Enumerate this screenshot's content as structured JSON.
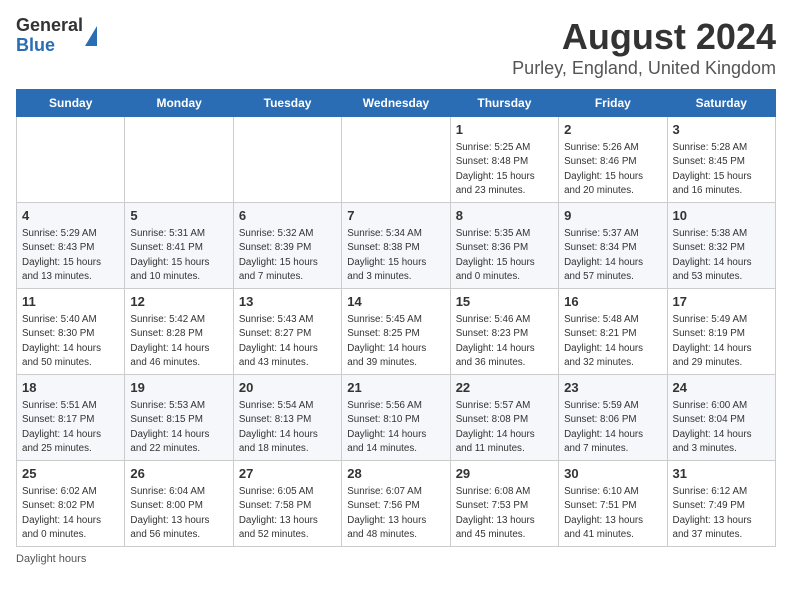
{
  "header": {
    "logo_general": "General",
    "logo_blue": "Blue",
    "title": "August 2024",
    "subtitle": "Purley, England, United Kingdom"
  },
  "days_of_week": [
    "Sunday",
    "Monday",
    "Tuesday",
    "Wednesday",
    "Thursday",
    "Friday",
    "Saturday"
  ],
  "weeks": [
    [
      {
        "day": "",
        "info": ""
      },
      {
        "day": "",
        "info": ""
      },
      {
        "day": "",
        "info": ""
      },
      {
        "day": "",
        "info": ""
      },
      {
        "day": "1",
        "info": "Sunrise: 5:25 AM\nSunset: 8:48 PM\nDaylight: 15 hours\nand 23 minutes."
      },
      {
        "day": "2",
        "info": "Sunrise: 5:26 AM\nSunset: 8:46 PM\nDaylight: 15 hours\nand 20 minutes."
      },
      {
        "day": "3",
        "info": "Sunrise: 5:28 AM\nSunset: 8:45 PM\nDaylight: 15 hours\nand 16 minutes."
      }
    ],
    [
      {
        "day": "4",
        "info": "Sunrise: 5:29 AM\nSunset: 8:43 PM\nDaylight: 15 hours\nand 13 minutes."
      },
      {
        "day": "5",
        "info": "Sunrise: 5:31 AM\nSunset: 8:41 PM\nDaylight: 15 hours\nand 10 minutes."
      },
      {
        "day": "6",
        "info": "Sunrise: 5:32 AM\nSunset: 8:39 PM\nDaylight: 15 hours\nand 7 minutes."
      },
      {
        "day": "7",
        "info": "Sunrise: 5:34 AM\nSunset: 8:38 PM\nDaylight: 15 hours\nand 3 minutes."
      },
      {
        "day": "8",
        "info": "Sunrise: 5:35 AM\nSunset: 8:36 PM\nDaylight: 15 hours\nand 0 minutes."
      },
      {
        "day": "9",
        "info": "Sunrise: 5:37 AM\nSunset: 8:34 PM\nDaylight: 14 hours\nand 57 minutes."
      },
      {
        "day": "10",
        "info": "Sunrise: 5:38 AM\nSunset: 8:32 PM\nDaylight: 14 hours\nand 53 minutes."
      }
    ],
    [
      {
        "day": "11",
        "info": "Sunrise: 5:40 AM\nSunset: 8:30 PM\nDaylight: 14 hours\nand 50 minutes."
      },
      {
        "day": "12",
        "info": "Sunrise: 5:42 AM\nSunset: 8:28 PM\nDaylight: 14 hours\nand 46 minutes."
      },
      {
        "day": "13",
        "info": "Sunrise: 5:43 AM\nSunset: 8:27 PM\nDaylight: 14 hours\nand 43 minutes."
      },
      {
        "day": "14",
        "info": "Sunrise: 5:45 AM\nSunset: 8:25 PM\nDaylight: 14 hours\nand 39 minutes."
      },
      {
        "day": "15",
        "info": "Sunrise: 5:46 AM\nSunset: 8:23 PM\nDaylight: 14 hours\nand 36 minutes."
      },
      {
        "day": "16",
        "info": "Sunrise: 5:48 AM\nSunset: 8:21 PM\nDaylight: 14 hours\nand 32 minutes."
      },
      {
        "day": "17",
        "info": "Sunrise: 5:49 AM\nSunset: 8:19 PM\nDaylight: 14 hours\nand 29 minutes."
      }
    ],
    [
      {
        "day": "18",
        "info": "Sunrise: 5:51 AM\nSunset: 8:17 PM\nDaylight: 14 hours\nand 25 minutes."
      },
      {
        "day": "19",
        "info": "Sunrise: 5:53 AM\nSunset: 8:15 PM\nDaylight: 14 hours\nand 22 minutes."
      },
      {
        "day": "20",
        "info": "Sunrise: 5:54 AM\nSunset: 8:13 PM\nDaylight: 14 hours\nand 18 minutes."
      },
      {
        "day": "21",
        "info": "Sunrise: 5:56 AM\nSunset: 8:10 PM\nDaylight: 14 hours\nand 14 minutes."
      },
      {
        "day": "22",
        "info": "Sunrise: 5:57 AM\nSunset: 8:08 PM\nDaylight: 14 hours\nand 11 minutes."
      },
      {
        "day": "23",
        "info": "Sunrise: 5:59 AM\nSunset: 8:06 PM\nDaylight: 14 hours\nand 7 minutes."
      },
      {
        "day": "24",
        "info": "Sunrise: 6:00 AM\nSunset: 8:04 PM\nDaylight: 14 hours\nand 3 minutes."
      }
    ],
    [
      {
        "day": "25",
        "info": "Sunrise: 6:02 AM\nSunset: 8:02 PM\nDaylight: 14 hours\nand 0 minutes."
      },
      {
        "day": "26",
        "info": "Sunrise: 6:04 AM\nSunset: 8:00 PM\nDaylight: 13 hours\nand 56 minutes."
      },
      {
        "day": "27",
        "info": "Sunrise: 6:05 AM\nSunset: 7:58 PM\nDaylight: 13 hours\nand 52 minutes."
      },
      {
        "day": "28",
        "info": "Sunrise: 6:07 AM\nSunset: 7:56 PM\nDaylight: 13 hours\nand 48 minutes."
      },
      {
        "day": "29",
        "info": "Sunrise: 6:08 AM\nSunset: 7:53 PM\nDaylight: 13 hours\nand 45 minutes."
      },
      {
        "day": "30",
        "info": "Sunrise: 6:10 AM\nSunset: 7:51 PM\nDaylight: 13 hours\nand 41 minutes."
      },
      {
        "day": "31",
        "info": "Sunrise: 6:12 AM\nSunset: 7:49 PM\nDaylight: 13 hours\nand 37 minutes."
      }
    ]
  ],
  "footer": "Daylight hours"
}
